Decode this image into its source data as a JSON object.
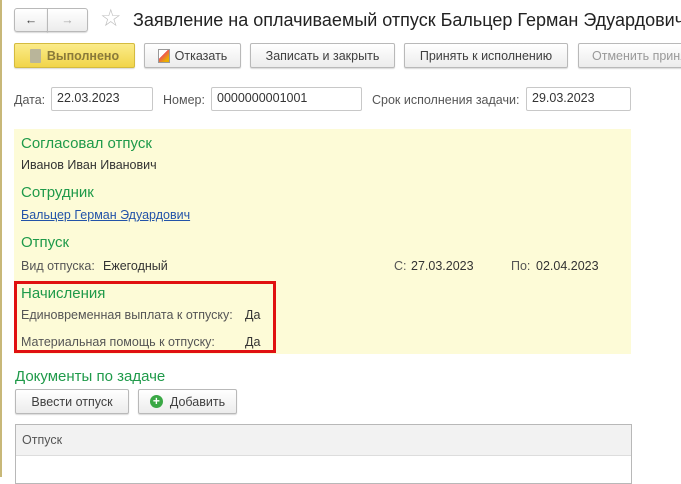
{
  "header": {
    "title": "Заявление на оплачиваемый отпуск Бальцер Герман Эдуардович"
  },
  "toolbar": {
    "done": "Выполнено",
    "refuse": "Отказать",
    "save_close": "Записать и закрыть",
    "accept": "Принять к исполнению",
    "cancel_accept": "Отменить принятие"
  },
  "fields": {
    "date_label": "Дата:",
    "date": "22.03.2023",
    "number_label": "Номер:",
    "number": "0000000001001",
    "deadline_label": "Срок исполнения задачи:",
    "deadline": "29.03.2023"
  },
  "info": {
    "approved_heading": "Согласовал отпуск",
    "approved_by": "Иванов Иван Иванович",
    "employee_heading": "Сотрудник",
    "employee": "Бальцер Герман Эдуардович",
    "vacation_heading": "Отпуск",
    "vacation_type_label": "Вид отпуска:",
    "vacation_type": "Ежегодный",
    "from_label": "С:",
    "from": "27.03.2023",
    "to_label": "По:",
    "to": "02.04.2023",
    "accruals_heading": "Начисления",
    "lump_label": "Единовременная выплата к отпуску:",
    "lump": "Да",
    "aid_label": "Материальная помощь к отпуску:",
    "aid": "Да"
  },
  "documents": {
    "heading": "Документы по задаче",
    "enter_vacation": "Ввести отпуск",
    "add": "Добавить",
    "column": "Отпуск"
  }
}
